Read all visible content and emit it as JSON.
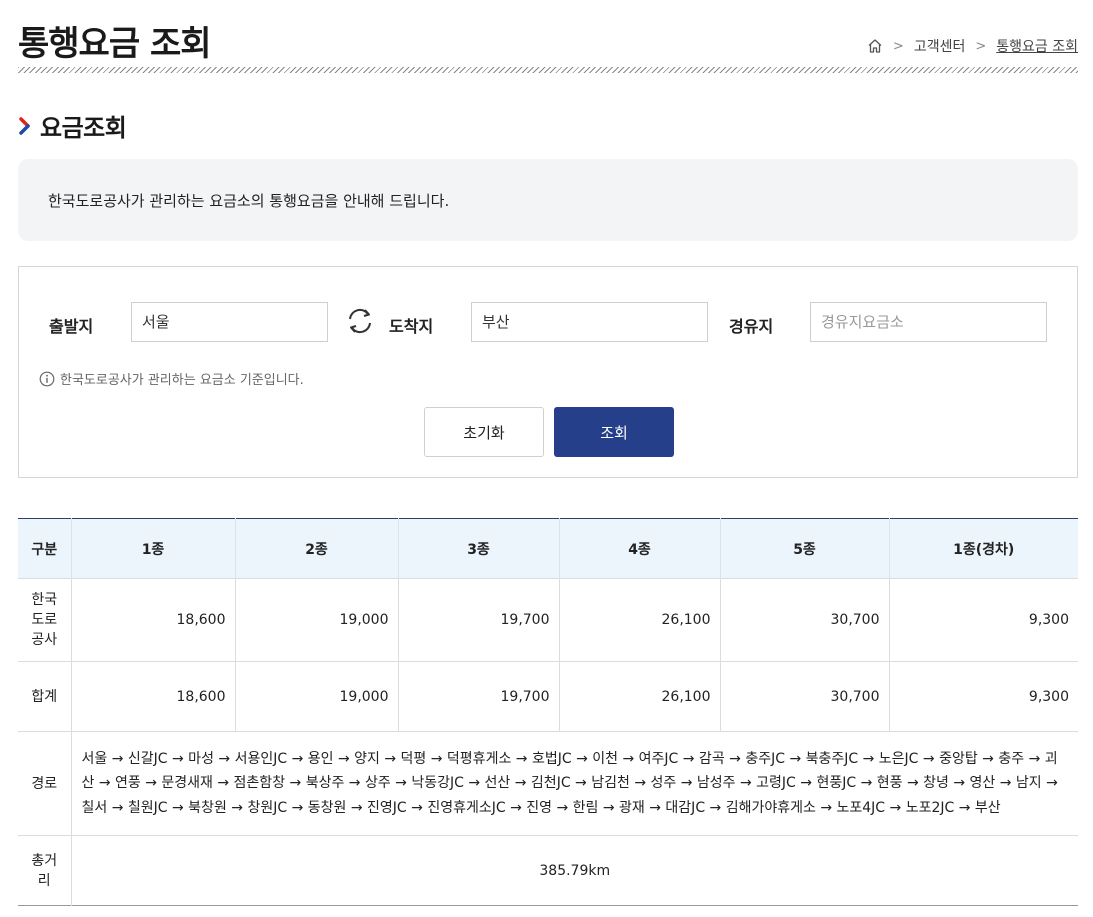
{
  "page": {
    "title": "통행요금 조회",
    "breadcrumb": [
      "고객센터",
      "통행요금 조회"
    ]
  },
  "section": {
    "title": "요금조회",
    "notice": "한국도로공사가 관리하는 요금소의 통행요금을 안내해 드립니다."
  },
  "search": {
    "origin_label": "출발지",
    "origin_value": "서울",
    "destination_label": "도착지",
    "destination_value": "부산",
    "waypoint_label": "경유지",
    "waypoint_placeholder": "경유지요금소",
    "hint": "한국도로공사가 관리하는 요금소 기준입니다.",
    "reset_label": "초기화",
    "search_label": "조회"
  },
  "table": {
    "headers": [
      "구분",
      "1종",
      "2종",
      "3종",
      "4종",
      "5종",
      "1종(경차)"
    ],
    "rows": [
      {
        "label": "한국\n도로\n공사",
        "values": [
          "18,600",
          "19,000",
          "19,700",
          "26,100",
          "30,700",
          "9,300"
        ]
      },
      {
        "label": "합계",
        "values": [
          "18,600",
          "19,000",
          "19,700",
          "26,100",
          "30,700",
          "9,300"
        ]
      }
    ],
    "route_label": "경로",
    "route": "서울 → 신갈JC → 마성 → 서용인JC → 용인 → 양지 → 덕평 → 덕평휴게소 → 호법JC → 이천 → 여주JC → 감곡 → 충주JC → 북충주JC → 노은JC → 중앙탑 → 충주 → 괴산 → 연풍 → 문경새재 → 점촌함창 → 북상주 → 상주 → 낙동강JC → 선산 → 김천JC → 남김천 → 성주 → 남성주 → 고령JC → 현풍JC → 현풍 → 창녕 → 영산 → 남지 → 칠서 → 칠원JC → 북창원 → 창원JC → 동창원 → 진영JC → 진영휴게소JC → 진영 → 한림 → 광재 → 대감JC → 김해가야휴게소 → 노포4JC → 노포2JC → 부산",
    "distance_label": "총거\n리",
    "distance": "385.79km"
  }
}
